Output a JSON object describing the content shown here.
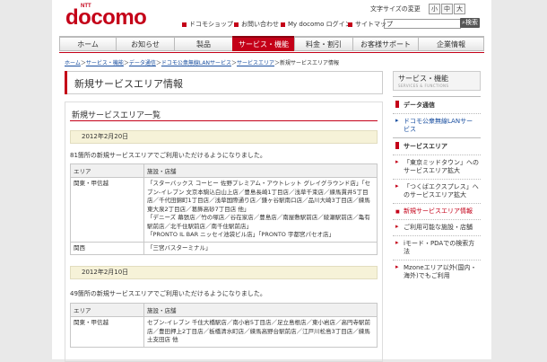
{
  "header": {
    "logo_small": "NTT",
    "logo": "docomo",
    "font_size_label": "文字サイズの変更",
    "font_size_buttons": [
      "小",
      "中",
      "大"
    ],
    "search_button": "検索",
    "links": [
      {
        "label": "ドコモショップ",
        "icon": "square-red-icon"
      },
      {
        "label": "お問い合わせ",
        "icon": "square-red-icon"
      },
      {
        "label": "My docomo ログイン",
        "icon": "square-red-icon"
      },
      {
        "label": "サイトマップ",
        "icon": "square-red-icon"
      }
    ]
  },
  "gnav": [
    {
      "label": "ホーム"
    },
    {
      "label": "お知らせ"
    },
    {
      "label": "製品"
    },
    {
      "label": "サービス・機能",
      "active": true
    },
    {
      "label": "料金・割引"
    },
    {
      "label": "お客様サポート"
    },
    {
      "label": "企業情報"
    }
  ],
  "breadcrumb": {
    "items": [
      "ホーム",
      "サービス・機能",
      "データ通信",
      "ドコモ公衆無線LANサービス",
      "サービスエリア"
    ],
    "separator": "＞",
    "current": "新規サービスエリア情報"
  },
  "page_title": "新規サービスエリア情報",
  "section_title": "新規サービスエリア一覧",
  "table_headers": {
    "area": "エリア",
    "shops": "施設・店舗"
  },
  "entries": [
    {
      "date": "2012年2月20日",
      "intro": "81箇所の新規サービスエリアでご利用いただけるようになりました。",
      "rows": [
        {
          "area": "関東・甲信越",
          "shops": "「スターバックス コーヒー 佐野プレミアム・アウトレット グレイグラウンド店」「セブン-イレブン 文京本駒込白山上店／豊島長崎1丁目店／浅草千束店／練馬貫井5丁目店／千代田錦町1丁目店／浅草国際通り店／鎌ヶ谷駅南口店／品川大崎3丁目店／練馬東大泉2丁目店／葛飾高砂7丁目店 他」\n「デニーズ 幕張店／竹の塚店／谷在家店／豊島店／南屋敷駅前店／綾瀬駅前店／亀有駅前店／北千住駅前店／南千住駅前店」\n「PRONTO IL BAR ニッセイ池袋ビル店」「PRONTO 宇都宮パセオ店」"
        },
        {
          "area": "関西",
          "shops": "「三宮バスターミナル」"
        }
      ]
    },
    {
      "date": "2012年2月10日",
      "intro": "49箇所の新規サービスエリアでご利用いただけるようになりました。",
      "rows": [
        {
          "area": "関東・甲信越",
          "shops": "セブン-イレブン 千住大橋駅店／南小岩5丁目店／足立島根店／東小岩店／高円寺駅前店／豊田押上2丁目店／板橋清水町店／練馬高野台駅前店／江戸川松島3丁目店／練馬土支田店 他"
        }
      ]
    }
  ],
  "sidebar": {
    "title": "サービス・機能",
    "title_en": "SERVICES & FUNCTIONS",
    "heads": [
      "データ通信",
      "サービスエリア"
    ],
    "service_link": "ドコモ公衆無線LANサービス",
    "links": [
      {
        "label": "「東京ミッドタウン」へのサービスエリア拡大"
      },
      {
        "label": "「つくばエクスプレス」へのサービスエリア拡大"
      },
      {
        "label": "新規サービスエリア情報",
        "selected": true
      },
      {
        "label": "ご利用可能な施設・店舗"
      },
      {
        "label": "iモード・PDAでの検索方法"
      },
      {
        "label": "Mzoneエリア以外(国内・海外)でもご利用"
      }
    ]
  }
}
